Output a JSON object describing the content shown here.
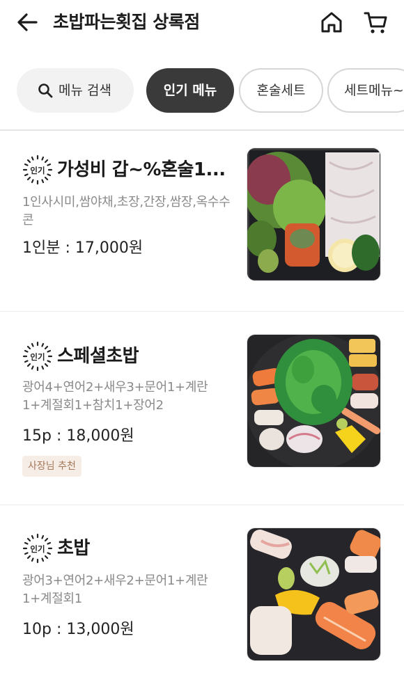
{
  "header": {
    "store_name": "초밥파는횟집 상록점"
  },
  "chips": {
    "search": "메뉴 검색",
    "popular": "인기 메뉴",
    "solo_set": "혼술세트",
    "set_menu": "세트메뉴~"
  },
  "badge": {
    "popular": "인기"
  },
  "menu": [
    {
      "name": "가성비 갑~%혼술1...",
      "desc": "1인사시미,쌈야채,초장,간장,쌈장,옥수수콘",
      "price": "1인분 : 17,000원",
      "tag": ""
    },
    {
      "name": "스페셜초밥",
      "desc": "광어4+연어2+새우3+문어1+계란1+계절회1+참치1+장어2",
      "price": "15p : 18,000원",
      "tag": "사장님 추천"
    },
    {
      "name": "초밥",
      "desc": "광어3+연어2+새우2+문어1+계란1+계절회1",
      "price": "10p : 13,000원",
      "tag": ""
    }
  ],
  "icons": {
    "back": "arrow-left-icon",
    "home": "home-icon",
    "cart": "cart-icon",
    "search": "search-icon"
  },
  "colors": {
    "active_chip": "#3a3a3a",
    "tag_bg": "#f6eee6",
    "tag_text": "#a5775a"
  }
}
